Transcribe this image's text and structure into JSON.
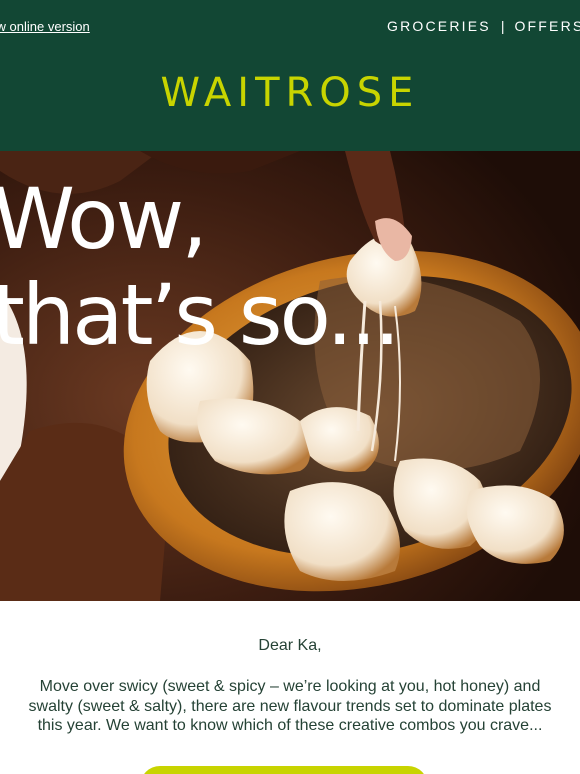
{
  "header": {
    "online_link": "View online version",
    "nav": [
      "GROCERIES",
      "OFFERS"
    ],
    "separator": "|",
    "logo": "WAITROSE"
  },
  "hero": {
    "headline_line1": "Wow,",
    "headline_line2": "that’s so..."
  },
  "body": {
    "greeting": "Dear Ka,",
    "intro": "Move over swicy (sweet & spicy – we’re looking at you, hot honey) and swalty (sweet & salty), there are new flavour trends set to dominate plates this year. We want to know which of these creative combos you crave..."
  },
  "colors": {
    "brand_green": "#124734",
    "brand_lime": "#c8d400",
    "body_text": "#254235"
  }
}
